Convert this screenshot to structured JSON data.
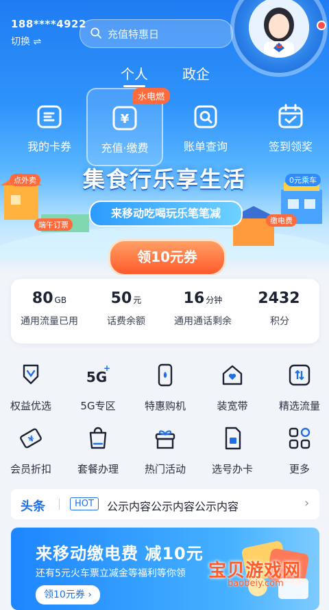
{
  "account": {
    "phone": "188****4922",
    "switch_label": "切换 ⇌"
  },
  "search": {
    "placeholder": "充值特惠日"
  },
  "segments": [
    "个人",
    "政企"
  ],
  "quick_actions": [
    {
      "label": "我的卡券",
      "icon": "card-voucher-icon"
    },
    {
      "label": "充值·缴费",
      "icon": "yuan-recharge-icon",
      "tag": "水电燃"
    },
    {
      "label": "账单查询",
      "icon": "bill-search-icon"
    },
    {
      "label": "签到领奖",
      "icon": "calendar-check-icon"
    }
  ],
  "banner": {
    "title": "集食行乐享生活",
    "subtitle": "来移动吃喝玩乐笔笔减",
    "chips": [
      "点外卖",
      "0元乘车",
      "端午订票",
      "缴电费"
    ],
    "cta": "领10元券"
  },
  "stats": [
    {
      "value": "80",
      "unit": "GB",
      "label": "通用流量已用"
    },
    {
      "value": "50",
      "unit": "元",
      "label": "话费余额"
    },
    {
      "value": "16",
      "unit": "分钟",
      "label": "通用通话剩余"
    },
    {
      "value": "2432",
      "unit": "",
      "label": "积分"
    }
  ],
  "services": [
    {
      "label": "权益优选",
      "icon": "medal-icon"
    },
    {
      "label": "5G专区",
      "icon": "5g-icon"
    },
    {
      "label": "特惠购机",
      "icon": "phone-icon"
    },
    {
      "label": "装宽带",
      "icon": "home-broadband-icon"
    },
    {
      "label": "精选流量",
      "icon": "data-traffic-icon"
    },
    {
      "label": "会员折扣",
      "icon": "discount-ticket-icon"
    },
    {
      "label": "套餐办理",
      "icon": "shopping-bag-icon"
    },
    {
      "label": "热门活动",
      "icon": "gift-icon"
    },
    {
      "label": "选号办卡",
      "icon": "sim-card-icon"
    },
    {
      "label": "更多",
      "icon": "more-grid-icon"
    }
  ],
  "headline": {
    "title": "头条",
    "badge": "HOT",
    "text": "公示内容公示内容公示内容"
  },
  "promo": {
    "title": "来移动缴电费 减10元",
    "subtitle": "还有5元火车票立减金等福利等你领",
    "button": "领10元券 ›"
  },
  "watermark": {
    "text": "宝贝游戏网",
    "url": "baobeiy.com"
  },
  "colors": {
    "primary": "#1e6fe6",
    "accent": "#ff5a2b"
  }
}
